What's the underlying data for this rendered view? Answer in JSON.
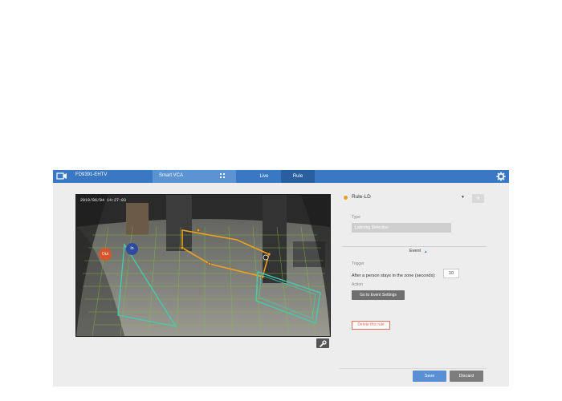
{
  "header": {
    "model": "FD9391-EHTV",
    "module": "Smart VCA",
    "tabs": [
      {
        "label": "Live",
        "active": false
      },
      {
        "label": "Rule",
        "active": true
      }
    ]
  },
  "video": {
    "timestamp": "2019/06/04 14:27:03",
    "counter_out": "Out",
    "counter_in": "In"
  },
  "rule": {
    "name": "Rule-LD",
    "add_label": "+",
    "type_label": "Type",
    "type_value": "Loitering Detection",
    "event_label": "Event",
    "trigger_label": "Trigger",
    "trigger_text": "After a person stays in the zone (seconds):",
    "trigger_seconds": "10",
    "action_label": "Action",
    "event_settings_button": "Go to Event Settings",
    "delete_button": "Delete this rule"
  },
  "footer": {
    "save": "Save",
    "discard": "Discard"
  },
  "colors": {
    "topbar": "#3a78c3",
    "active_tab": "#2a5f9f",
    "zone_orange": "#f0a020",
    "zone_teal": "#3ecfb0",
    "grid_green": "#7fc240",
    "out_badge": "#d4562a",
    "in_badge": "#2d4a9c"
  }
}
